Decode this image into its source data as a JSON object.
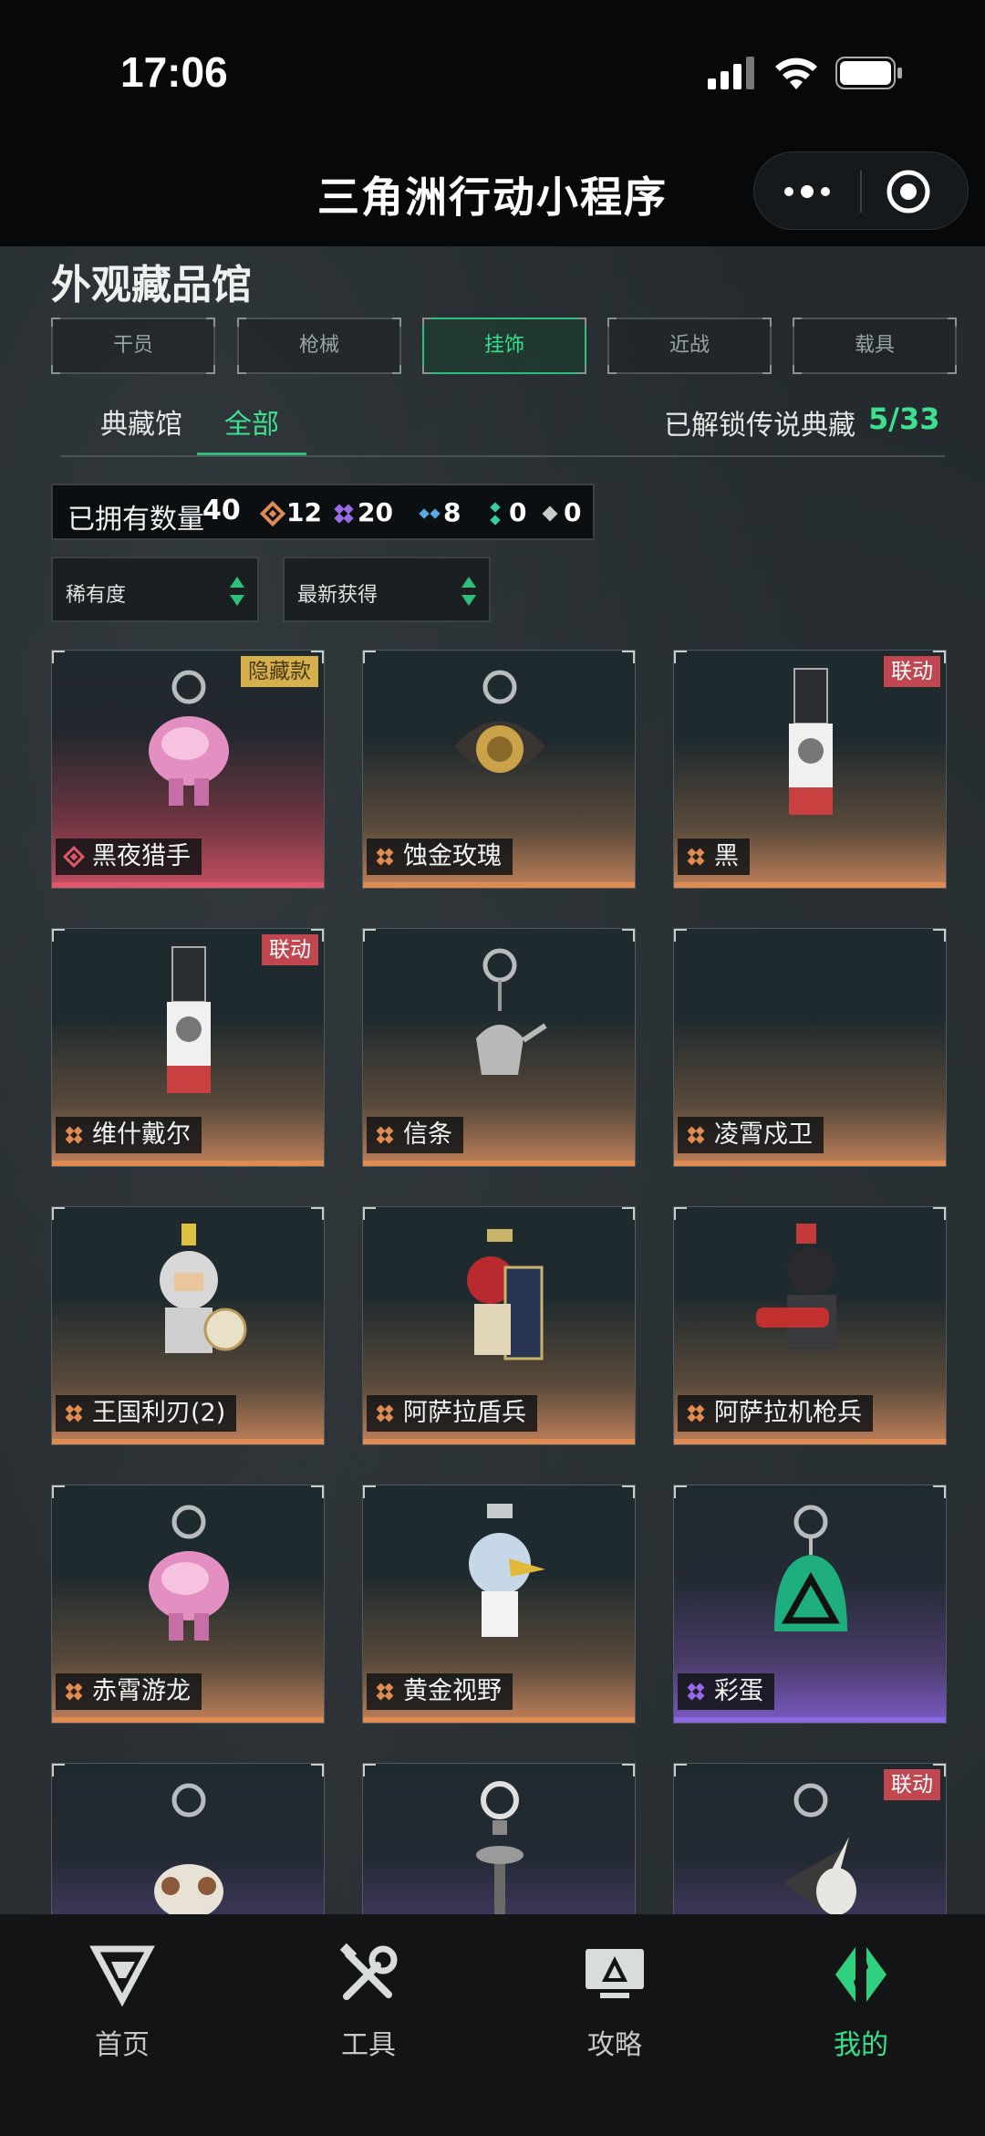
{
  "status_bar": {
    "time": "17:06"
  },
  "header": {
    "title": "三角洲行动小程序"
  },
  "page": {
    "title": "外观藏品馆"
  },
  "category_tabs": [
    {
      "label": "干员"
    },
    {
      "label": "枪械"
    },
    {
      "label": "挂饰",
      "active": true
    },
    {
      "label": "近战"
    },
    {
      "label": "载具"
    }
  ],
  "sub_tabs": [
    {
      "label": "典藏馆"
    },
    {
      "label": "全部",
      "active": true
    }
  ],
  "legend_unlock": {
    "label": "已解锁传说典藏",
    "count": "5/33"
  },
  "owned": {
    "label": "已拥有数量",
    "total": "40",
    "rarities": [
      {
        "rarity": "orange",
        "color": "#e08b52",
        "count": "12"
      },
      {
        "rarity": "purple",
        "color": "#9a6ae6",
        "count": "20"
      },
      {
        "rarity": "blue",
        "color": "#5aa8e6",
        "count": "8"
      },
      {
        "rarity": "green",
        "color": "#38d0a0",
        "count": "0"
      },
      {
        "rarity": "white",
        "color": "#c8ccca",
        "count": "0"
      }
    ]
  },
  "filters": {
    "rarity": "稀有度",
    "sort": "最新获得"
  },
  "items": [
    {
      "name": "黑夜猎手",
      "rarity": "red",
      "badge": "隐藏款",
      "icon": "pink-dragon-charm-icon"
    },
    {
      "name": "蚀金玫瑰",
      "rarity": "orange",
      "badge": "",
      "icon": "gold-rose-charm-icon"
    },
    {
      "name": "黑",
      "rarity": "orange",
      "badge": "联动",
      "icon": "card-charm-icon"
    },
    {
      "name": "维什戴尔",
      "rarity": "orange",
      "badge": "联动",
      "icon": "card-charm-icon"
    },
    {
      "name": "信条",
      "rarity": "orange",
      "badge": "",
      "icon": "teapot-charm-icon"
    },
    {
      "name": "凌霄戍卫",
      "rarity": "orange",
      "badge": "",
      "icon": "empty-charm-icon"
    },
    {
      "name": "王国利刃(2)",
      "rarity": "orange",
      "badge": "",
      "icon": "knight-charm-icon"
    },
    {
      "name": "阿萨拉盾兵",
      "rarity": "orange",
      "badge": "",
      "icon": "shield-soldier-charm-icon"
    },
    {
      "name": "阿萨拉机枪兵",
      "rarity": "orange",
      "badge": "",
      "icon": "gunner-charm-icon"
    },
    {
      "name": "赤霄游龙",
      "rarity": "orange",
      "badge": "",
      "icon": "pink-dragon-charm-icon"
    },
    {
      "name": "黄金视野",
      "rarity": "orange",
      "badge": "",
      "icon": "bird-charm-icon"
    },
    {
      "name": "彩蛋",
      "rarity": "purple",
      "badge": "",
      "icon": "triangle-tag-charm-icon"
    },
    {
      "name": "",
      "rarity": "purple",
      "badge": "",
      "icon": "sheep-charm-icon"
    },
    {
      "name": "",
      "rarity": "purple",
      "badge": "",
      "icon": "key-charm-icon"
    },
    {
      "name": "",
      "rarity": "purple",
      "badge": "联动",
      "icon": "rabbit-charm-icon"
    }
  ],
  "bottom_nav": [
    {
      "label": "首页",
      "icon": "home-logo-icon"
    },
    {
      "label": "工具",
      "icon": "tools-icon"
    },
    {
      "label": "攻略",
      "icon": "guide-monitor-icon"
    },
    {
      "label": "我的",
      "icon": "profile-logo-icon",
      "active": true
    }
  ]
}
